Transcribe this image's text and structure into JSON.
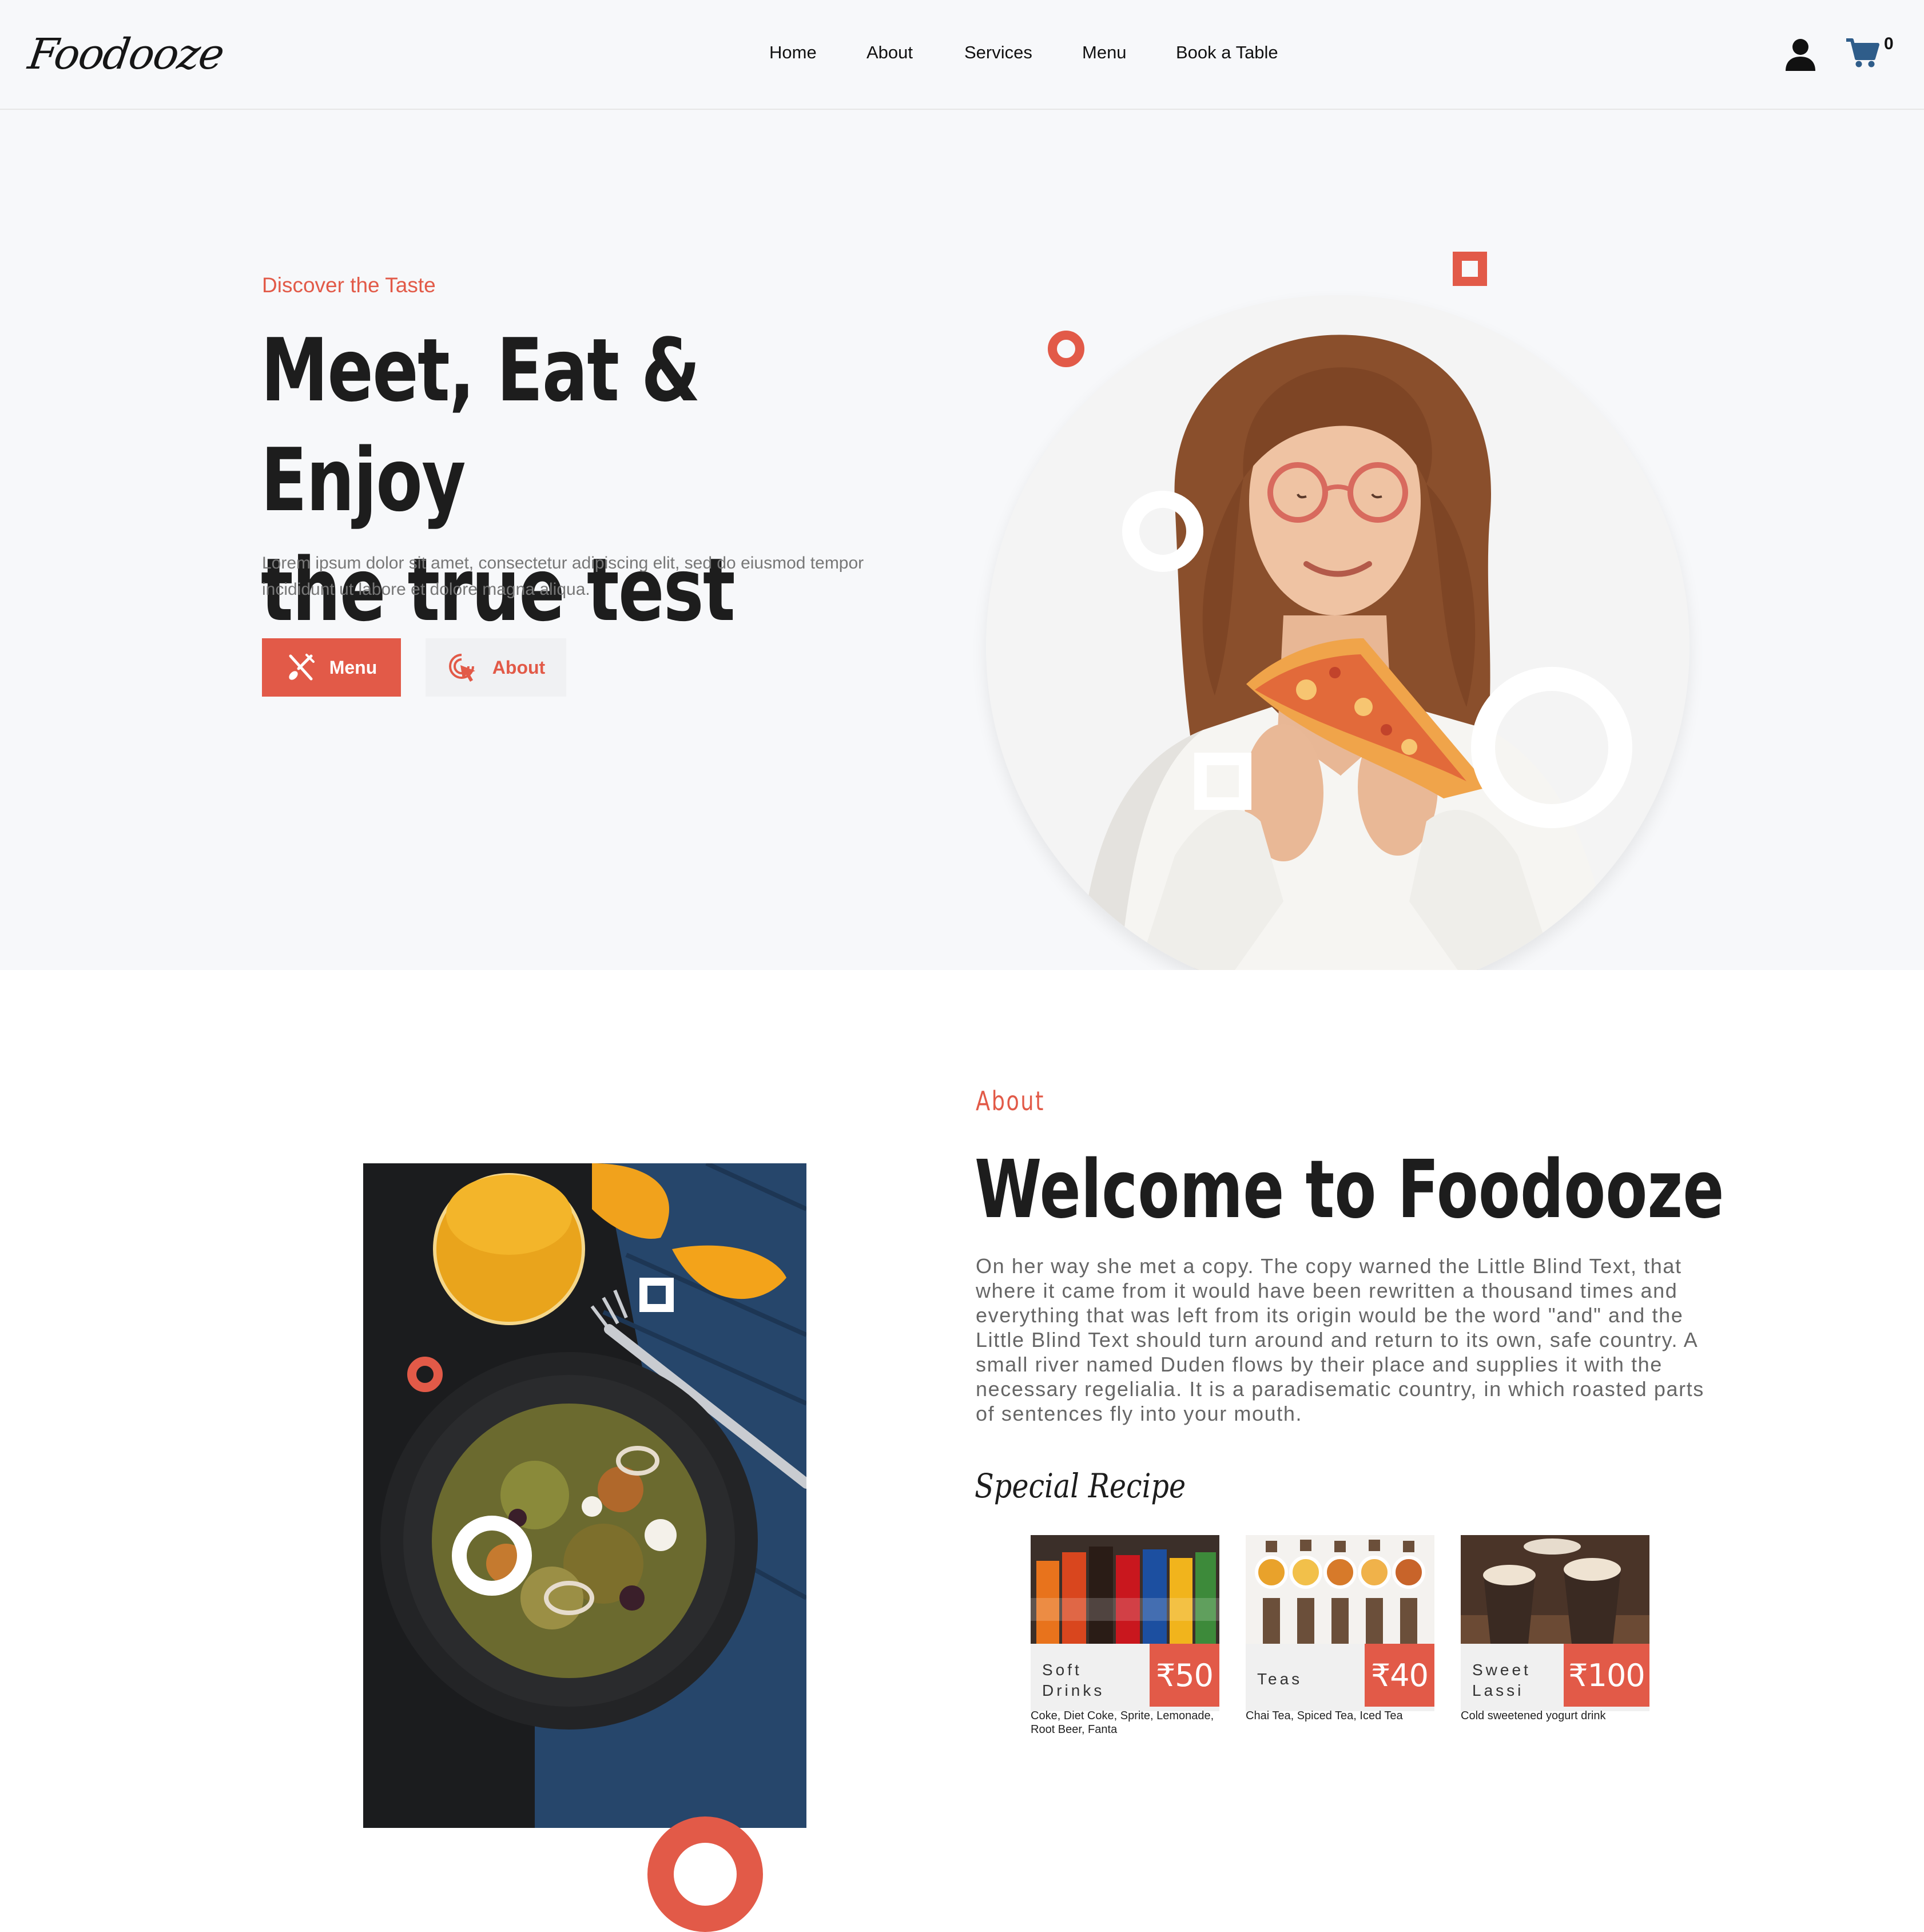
{
  "header": {
    "logo": "Foodooze",
    "nav": [
      "Home",
      "About",
      "Services",
      "Menu",
      "Book a Table"
    ],
    "cart_count": "0"
  },
  "hero": {
    "kicker": "Discover the Taste",
    "title_line1": "Meet, Eat & Enjoy",
    "title_line2": "the true test",
    "description": "Lorem ipsum dolor sit amet, consectetur adipiscing elit, sed do eiusmod tempor incididunt ut labore et dolore magna aliqua.",
    "menu_button": "Menu",
    "about_button": "About"
  },
  "about": {
    "kicker": "About",
    "title": "Welcome to Foodooze",
    "text": "On her way she met a copy. The copy warned the Little Blind Text, that where it came from it would have been rewritten a thousand times and everything that was left from its origin would be the word \"and\" and the Little Blind Text should turn around and return to its own, safe country. A small river named Duden flows by their place and supplies it with the necessary regelialia. It is a paradisematic country, in which roasted parts of sentences fly into your mouth.",
    "special_title": "Special Recipe",
    "recipes": [
      {
        "name_line1": "Soft",
        "name_line2": "Drinks",
        "price": "₹50",
        "description": "Coke, Diet Coke, Sprite, Lemonade, Root Beer, Fanta"
      },
      {
        "name_line1": "Teas",
        "name_line2": "",
        "price": "₹40",
        "description": "Chai Tea, Spiced Tea, Iced Tea"
      },
      {
        "name_line1": "Sweet",
        "name_line2": "Lassi",
        "price": "₹100",
        "description": "Cold sweetened yogurt drink"
      }
    ]
  },
  "colors": {
    "accent": "#e25a48",
    "cart_blue": "#2f5d8a",
    "hero_bg": "#f7f8fa"
  },
  "icons": [
    "user-icon",
    "cart-icon",
    "utensils-icon",
    "cursor-click-icon"
  ]
}
